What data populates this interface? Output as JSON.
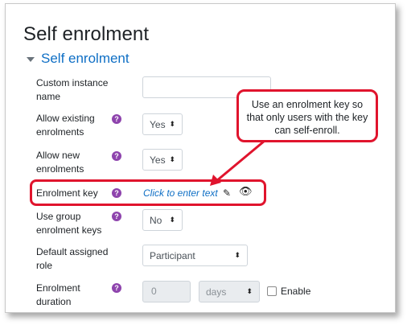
{
  "page_title": "Self enrolment",
  "section": {
    "title": "Self enrolment"
  },
  "form": {
    "custom_instance_name": {
      "label": "Custom instance name",
      "value": ""
    },
    "allow_existing": {
      "label": "Allow existing enrolments",
      "value": "Yes",
      "help": "?"
    },
    "allow_new": {
      "label": "Allow new enrolments",
      "value": "Yes",
      "help": "?"
    },
    "enrolment_key": {
      "label": "Enrolment key",
      "placeholder_text": "Click to enter text",
      "help": "?"
    },
    "use_group_keys": {
      "label": "Use group enrolment keys",
      "value": "No",
      "help": "?"
    },
    "default_role": {
      "label": "Default assigned role",
      "value": "Participant"
    },
    "enrolment_duration": {
      "label": "Enrolment duration",
      "value": "0",
      "unit": "days",
      "enable_label": "Enable",
      "help": "?"
    }
  },
  "callout": {
    "text": "Use an enrolment key so that only users with the key can self-enroll."
  },
  "icons": {
    "help": "question-icon",
    "edit": "pencil-icon",
    "reveal": "eye-icon",
    "select": "sort-arrows-icon"
  },
  "colors": {
    "accent": "#0f6fc5",
    "help": "#8e44ad",
    "annotation": "#e0142d"
  }
}
